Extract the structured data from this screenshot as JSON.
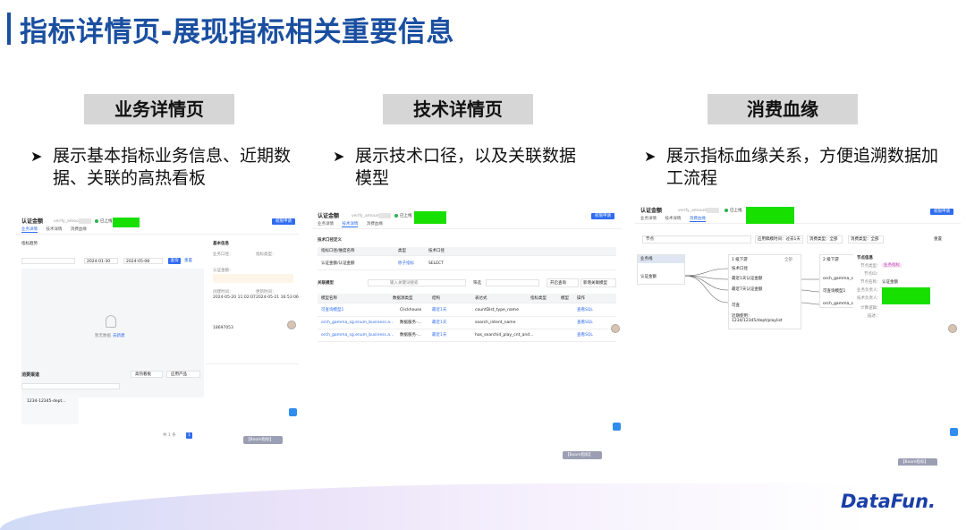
{
  "page_title": "指标详情页-展现指标相关重要信息",
  "sections": [
    {
      "tag": "业务详情页",
      "bullet": "展示基本指标业务信息、近期数据、关联的高热看板"
    },
    {
      "tag": "技术详情页",
      "bullet": "展示技术口径，以及关联数据模型"
    },
    {
      "tag": "消费血缘",
      "bullet": "展示指标血缘关系，方便追溯数据加工流程"
    }
  ],
  "shots": {
    "common": {
      "title": "认证金额",
      "metric_id": "verify_amount",
      "status": "已上线",
      "apply_button": "权限申请",
      "tabs": [
        "业务详情",
        "技术详情",
        "消费血缘"
      ]
    },
    "business": {
      "trend_title": "指标趋势",
      "date_from": "2024-01-30",
      "date_to": "2024-05-08",
      "query_button": "查询",
      "reset_link": "重置",
      "empty_text": "暂无数据",
      "create_link": "去新建",
      "info_title": "基本信息",
      "fields": [
        "业务口径：",
        "指标类型：",
        "认证金额：",
        "创建时间：",
        "更新时间："
      ],
      "created": "2024-05-20 11:02:07",
      "updated": "2024-05-21 16:53:06",
      "owner_value": "18697053",
      "consume_title": "消费渠道",
      "board_tab": "高热看板",
      "product_tab": "应用产品",
      "card_text": "1234-12345-dept...",
      "pager_total": "共 1 条",
      "pager_page": "1",
      "floating": "【Boom指标】"
    },
    "technical": {
      "section_title": "技术口径定义",
      "col_headers": [
        "指标口径/维度名称",
        "类型",
        "技术口径"
      ],
      "def_row": [
        "认证金额/认证金额",
        "原子指标",
        "SELECT"
      ],
      "model_title": "关联模型",
      "search_placeholder": "输入关键词搜索",
      "filter_label": "筛选",
      "open_button": "开启查询",
      "new_button": "新增关联模型",
      "table_headers": [
        "模型名称",
        "数据源类型",
        "结构",
        "表达式",
        "指标类型",
        "模型",
        "操作"
      ],
      "rows": [
        [
          "可查询模型1",
          "Clickhouse",
          "最近1天",
          "countDist_type_name",
          "查看SQL"
        ],
        [
          "orch_gamma_sg.enum_business.a...",
          "数据服务-...",
          "最近1天",
          "search_intent_name",
          "查看SQL"
        ],
        [
          "orch_gamma_sg.enum_business.a...",
          "数据服务-...",
          "最近1天",
          "has_searchid_play_cnt_and...",
          "查看SQL"
        ]
      ],
      "floating": "【Boom指标】"
    },
    "lineage": {
      "filter_node": "节点",
      "filter_range": "应用稿模时间：过去1天",
      "filter_consume": "消费类型：全部",
      "filter_status": "消费类型：全部",
      "reset": "重置",
      "root_header": "业务线",
      "root_node": "认证金额",
      "mid_header": "1 级下游",
      "mid_all": "全部",
      "mid_sub": "技术口径",
      "mid_items": [
        "最近1天认证金额",
        "最近7天认证金额"
      ],
      "mid_model_title": "可查",
      "mid_model_text": "近期使用：1234/12345/dept/playlist",
      "right_header": "2 级下游",
      "right_items": [
        "orch_gamma_sc...",
        "可查询模型1",
        "orch_gamma_sc..."
      ],
      "detail_title": "节点信息",
      "detail_fields": [
        "节点类型：",
        "节点ID：",
        "节点名称：",
        "业务负责人：",
        "技术负责人：",
        "计算逻辑：",
        "描述："
      ],
      "detail_type_tag": "业务指标",
      "detail_name": "认证金额",
      "floating": "【Boom指标】"
    }
  },
  "logo": "DataFun."
}
